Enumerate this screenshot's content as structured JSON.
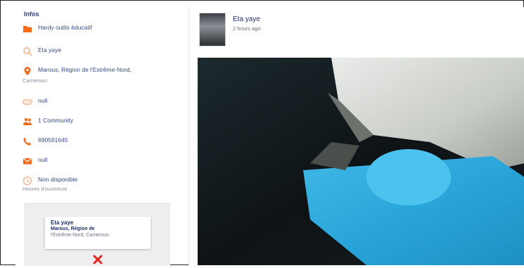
{
  "info": {
    "title": "Infos",
    "rows": [
      {
        "icon": "folder-icon",
        "text": "Hardy outils éducatif"
      },
      {
        "icon": "search-icon",
        "text": "Eta yaye"
      },
      {
        "icon": "map-pin-icon",
        "text": "Marous, Région de l'Extrême-Nord,",
        "sub": "Cameroun"
      },
      {
        "icon": "link-icon",
        "text": "null"
      },
      {
        "icon": "users-icon",
        "text": "1 Community"
      },
      {
        "icon": "phone-icon",
        "text": "690591645"
      },
      {
        "icon": "mail-icon",
        "text": "null"
      },
      {
        "icon": "clock-icon",
        "text": "Non disponible",
        "sub": "Heures d'ouverture"
      }
    ]
  },
  "map": {
    "popup_name": "Eta yaye",
    "popup_addr1": "Marous, Région de",
    "popup_addr2": "l'Extrême-Nord, Cameroun"
  },
  "post": {
    "author": "Eta yaye",
    "time": "2 hours ago"
  },
  "colors": {
    "icon_orange": "#f26b1d",
    "link_blue": "#2c3b8f"
  }
}
